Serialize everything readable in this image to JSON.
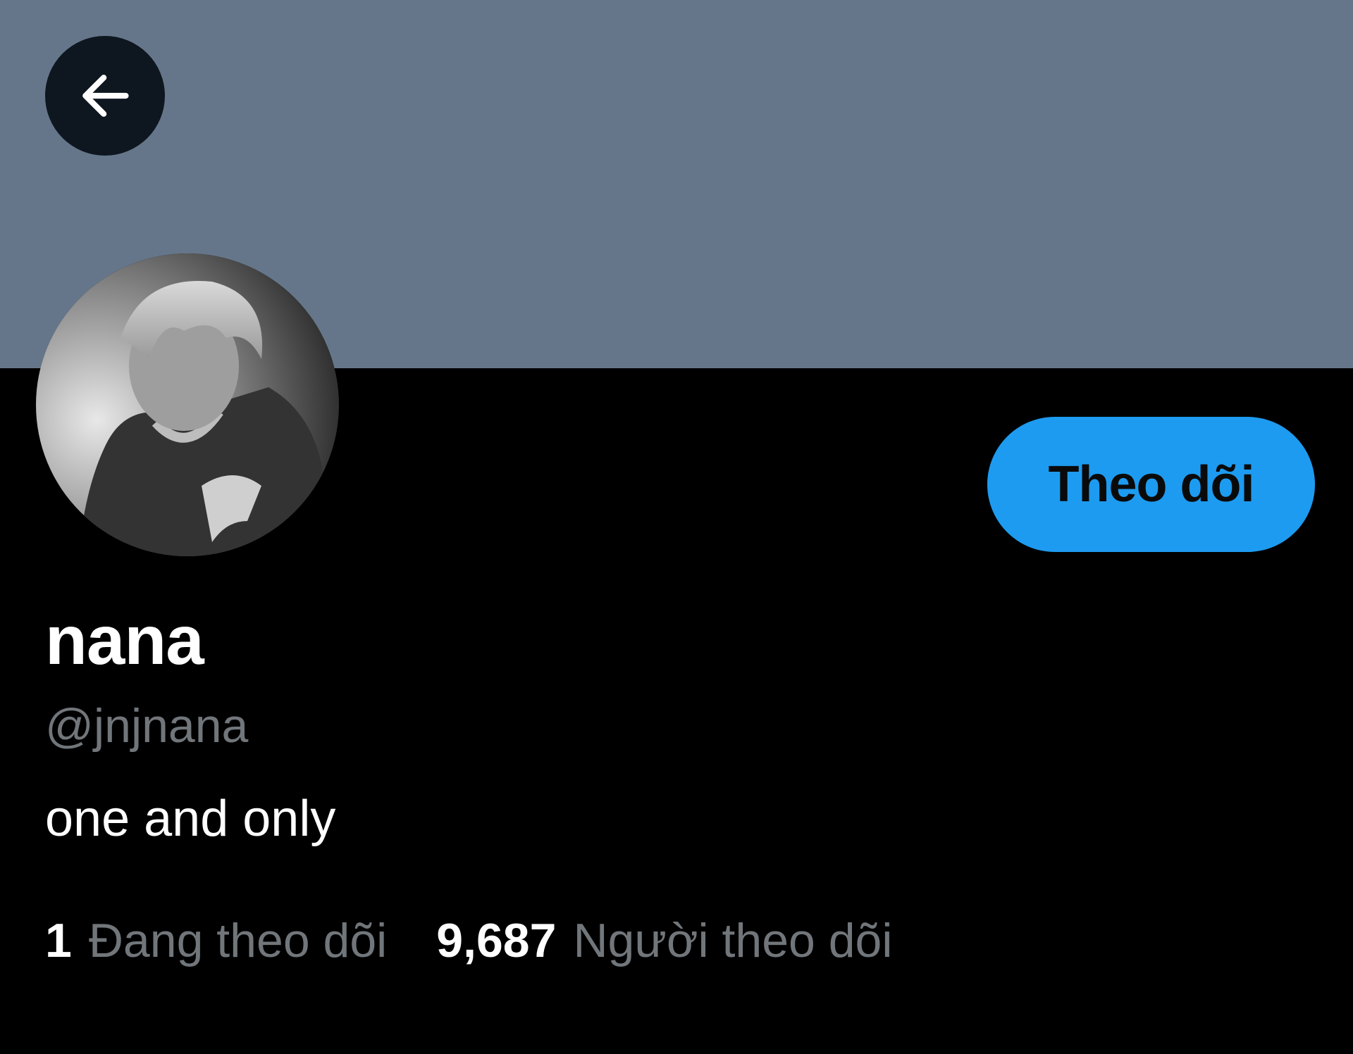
{
  "colors": {
    "banner": "#66768a",
    "background": "#000000",
    "accent": "#1d9bf0",
    "muted_text": "#71767b",
    "primary_text": "#ffffff"
  },
  "header": {
    "back_icon": "arrow-left-icon"
  },
  "profile": {
    "name": "nana",
    "handle": "@jnjnana",
    "bio": "one and only",
    "follow_label": "Theo dõi",
    "stats": [
      {
        "count": "1",
        "label": "Đang theo dõi"
      },
      {
        "count": "9,687",
        "label": "Người theo dõi"
      }
    ]
  }
}
